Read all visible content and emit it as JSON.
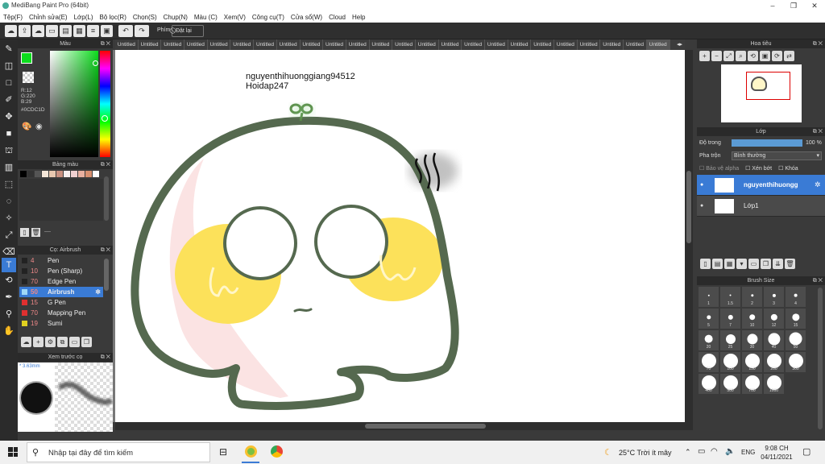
{
  "window": {
    "title": "MediBang Paint Pro (64bit)",
    "controls": [
      "–",
      "❐",
      "✕"
    ]
  },
  "menu": [
    "Tệp(F)",
    "Chỉnh sửa(E)",
    "Lớp(L)",
    "Bộ lọc(R)",
    "Chọn(S)",
    "Chụp(N)",
    "Màu (C)",
    "Xem(V)",
    "Công cụ(T)",
    "Cửa sổ(W)",
    "Cloud",
    "Help"
  ],
  "toolbar": {
    "shortcut_label": "Phím",
    "reset_label": "Đặt lại"
  },
  "tabs": {
    "items": [
      "Untitled",
      "Untitled",
      "Untitled",
      "Untitled",
      "Untitled",
      "Untitled",
      "Untitled",
      "Untitled",
      "Untitled",
      "Untitled",
      "Untitled",
      "Untitled",
      "Untitled",
      "Untitled",
      "Untitled",
      "Untitled",
      "Untitled",
      "Untitled",
      "Untitled",
      "Untitled",
      "Untitled",
      "Untitled",
      "Untitled",
      "Untitled"
    ],
    "active_index": 23
  },
  "color_panel": {
    "title": "Màu",
    "r": "R:12",
    "g": "G:220",
    "b": "B:29",
    "hex": "#0CDC1D",
    "fg_color": "#0CDC1D"
  },
  "palette_panel": {
    "title": "Bảng màu",
    "colors": [
      "#000000",
      "#333333",
      "#555555",
      "#f5e6d8",
      "#e8c8b0",
      "#c89080",
      "#f8f0f0",
      "#f0d0d0",
      "#e8b0a0",
      "#d89070",
      "#ffffff"
    ],
    "footer": "----"
  },
  "brush_panel": {
    "title": "Cọ: Airbrush",
    "items": [
      {
        "num": "4",
        "name": "Pen",
        "color": "#222"
      },
      {
        "num": "10",
        "name": "Pen (Sharp)",
        "color": "#222"
      },
      {
        "num": "70",
        "name": "Edge Pen",
        "color": "#222"
      },
      {
        "num": "50",
        "name": "Airbrush",
        "color": "#9fd8f8"
      },
      {
        "num": "15",
        "name": "G Pen",
        "color": "#e03030"
      },
      {
        "num": "70",
        "name": "Mapping Pen",
        "color": "#e03030"
      },
      {
        "num": "19",
        "name": "Sumi",
        "color": "#e0d020"
      }
    ]
  },
  "preview_panel": {
    "title": "Xem trước cọ",
    "size": "* 3.63mm"
  },
  "canvas": {
    "text_line1": "nguyenthihuonggiang94512",
    "text_line2": "Hoidap247"
  },
  "navigator": {
    "title": "Hoa tiêu"
  },
  "layer_panel": {
    "title": "Lớp",
    "opacity_label": "Độ trong",
    "opacity_value": "100 %",
    "opacity": 1.0,
    "blend_label": "Pha trộn",
    "blend_value": "Bình thường",
    "protect_alpha": "Bảo vệ alpha",
    "clip": "Xén bớt",
    "lock": "Khóa",
    "layers": [
      {
        "name": "nguyenthihuongg",
        "active": true
      },
      {
        "name": "Lớp1",
        "active": false
      }
    ]
  },
  "brush_size": {
    "title": "Brush Size",
    "sizes": [
      "1",
      "1.5",
      "2",
      "3",
      "4",
      "5",
      "7",
      "10",
      "12",
      "15",
      "20",
      "25",
      "30",
      "40",
      "50",
      "70",
      "100",
      "150",
      "200",
      "300",
      "400",
      "500",
      "700",
      "1000"
    ]
  },
  "taskbar": {
    "search_placeholder": "Nhập tại đây để tìm kiếm",
    "weather": "25°C  Trời ít mây",
    "lang": "ENG",
    "time": "9:08 CH",
    "date": "04/11/2021"
  }
}
